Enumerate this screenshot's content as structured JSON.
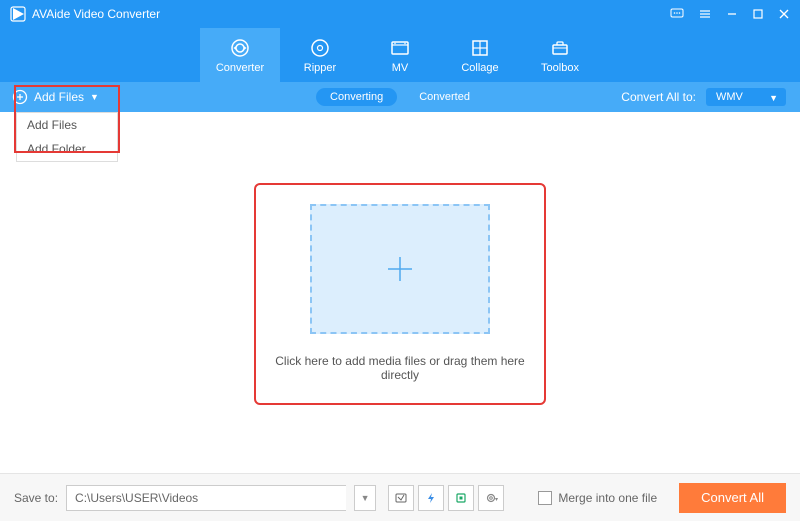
{
  "titlebar": {
    "title": "AVAide Video Converter"
  },
  "nav": {
    "converter": "Converter",
    "ripper": "Ripper",
    "mv": "MV",
    "collage": "Collage",
    "toolbox": "Toolbox"
  },
  "subbar": {
    "add_files": "Add Files",
    "converting": "Converting",
    "converted": "Converted",
    "convert_all_to": "Convert All to:",
    "format": "WMV"
  },
  "dropdown": {
    "add_files": "Add Files",
    "add_folder": "Add Folder"
  },
  "drop": {
    "text": "Click here to add media files or drag them here directly"
  },
  "footer": {
    "save_to": "Save to:",
    "path": "C:\\Users\\USER\\Videos",
    "merge": "Merge into one file",
    "convert_all": "Convert All"
  }
}
